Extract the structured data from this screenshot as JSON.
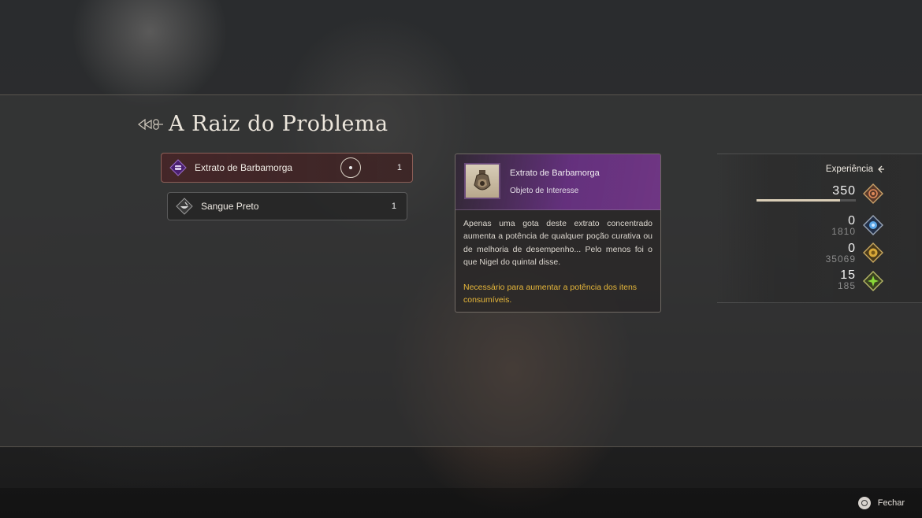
{
  "quest": {
    "title": "A Raiz do Problema"
  },
  "items": [
    {
      "name": "Extrato de Barbamorga",
      "quantity": "1",
      "selected": true,
      "icon": "purple-chest-icon"
    },
    {
      "name": "Sangue Preto",
      "quantity": "1",
      "selected": false,
      "icon": "bowl-icon"
    }
  ],
  "detail": {
    "name": "Extrato de Barbamorga",
    "type": "Objeto de Interesse",
    "description": "Apenas uma gota deste extrato concentrado aumenta a potência de qualquer poção curativa ou de melhoria de desempenho... Pelo menos foi o que Nigel do quintal disse.",
    "note": "Necessário para aumentar a potência dos itens consumíveis.",
    "accent_color": "#8c3cb4",
    "note_color": "#e8b83a"
  },
  "rewards": {
    "title": "Experiência",
    "experience": {
      "value": "350",
      "progress": 0.84,
      "icon": "experience-emblem-icon"
    },
    "rows": [
      {
        "value": "0",
        "total": "1810",
        "icon": "blue-ability-icon"
      },
      {
        "value": "0",
        "total": "35069",
        "icon": "gold-gil-icon"
      },
      {
        "value": "15",
        "total": "185",
        "icon": "green-star-icon"
      }
    ]
  },
  "controls": {
    "close_label": "Fechar",
    "close_icon": "circle-button-icon"
  }
}
